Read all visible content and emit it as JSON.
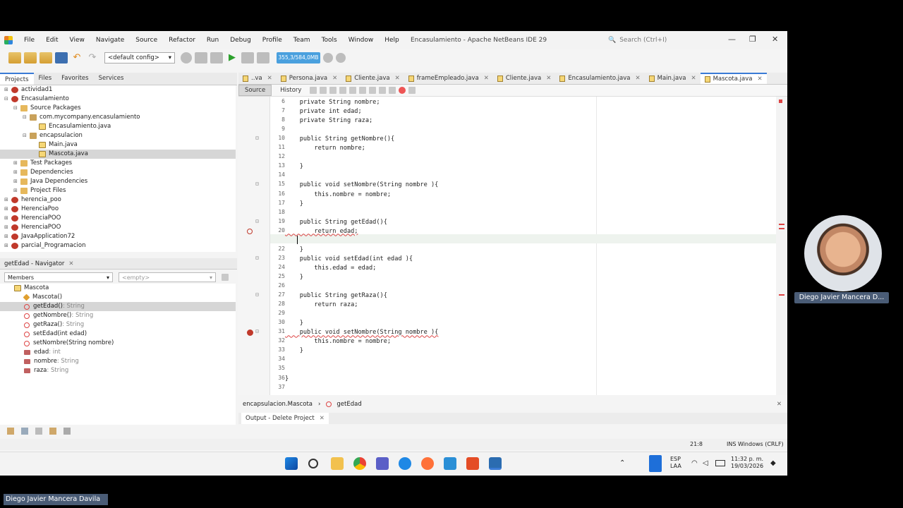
{
  "window": {
    "title": "Encasulamiento - Apache NetBeans IDE 29",
    "search_placeholder": "Search (Ctrl+I)",
    "menu": [
      "File",
      "Edit",
      "View",
      "Navigate",
      "Source",
      "Refactor",
      "Run",
      "Debug",
      "Profile",
      "Team",
      "Tools",
      "Window",
      "Help"
    ]
  },
  "toolbar": {
    "config": "<default config>",
    "memory": "355,3/584,0MB"
  },
  "left_tabs": [
    "Projects",
    "Files",
    "Favorites",
    "Services"
  ],
  "projects": [
    {
      "label": "actividad1",
      "indent": 0,
      "icon": "proj",
      "exp": "⊞"
    },
    {
      "label": "Encasulamiento",
      "indent": 0,
      "icon": "proj",
      "exp": "⊟"
    },
    {
      "label": "Source Packages",
      "indent": 1,
      "icon": "folder",
      "exp": "⊟"
    },
    {
      "label": "com.mycompany.encasulamiento",
      "indent": 2,
      "icon": "pkg",
      "exp": "⊟"
    },
    {
      "label": "Encasulamiento.java",
      "indent": 3,
      "icon": "java",
      "exp": ""
    },
    {
      "label": "encapsulacion",
      "indent": 2,
      "icon": "pkg",
      "exp": "⊟"
    },
    {
      "label": "Main.java",
      "indent": 3,
      "icon": "java",
      "exp": ""
    },
    {
      "label": "Mascota.java",
      "indent": 3,
      "icon": "java",
      "exp": "",
      "selected": true
    },
    {
      "label": "Test Packages",
      "indent": 1,
      "icon": "folder",
      "exp": "⊞"
    },
    {
      "label": "Dependencies",
      "indent": 1,
      "icon": "folder",
      "exp": "⊞"
    },
    {
      "label": "Java Dependencies",
      "indent": 1,
      "icon": "folder",
      "exp": "⊞"
    },
    {
      "label": "Project Files",
      "indent": 1,
      "icon": "folder",
      "exp": "⊞"
    },
    {
      "label": "herencia_poo",
      "indent": 0,
      "icon": "proj",
      "exp": "⊞"
    },
    {
      "label": "HerenciaPoo",
      "indent": 0,
      "icon": "proj",
      "exp": "⊞"
    },
    {
      "label": "HerenciaPOO",
      "indent": 0,
      "icon": "proj",
      "exp": "⊞"
    },
    {
      "label": "HerenciaPOO",
      "indent": 0,
      "icon": "proj",
      "exp": "⊞"
    },
    {
      "label": "JavaApplication72",
      "indent": 0,
      "icon": "proj",
      "exp": "⊞"
    },
    {
      "label": "parcial_Programacion",
      "indent": 0,
      "icon": "proj",
      "exp": "⊞"
    }
  ],
  "navigator": {
    "title": "getEdad - Navigator",
    "members_label": "Members",
    "filter_label": "<empty>",
    "root": "Mascota",
    "items": [
      {
        "name": "Mascota()",
        "type": "",
        "kind": "ctor"
      },
      {
        "name": "getEdad()",
        "type": " : String",
        "kind": "method",
        "selected": true
      },
      {
        "name": "getNombre()",
        "type": " : String",
        "kind": "method"
      },
      {
        "name": "getRaza()",
        "type": " : String",
        "kind": "method"
      },
      {
        "name": "setEdad(int edad)",
        "type": "",
        "kind": "method"
      },
      {
        "name": "setNombre(String nombre)",
        "type": "",
        "kind": "method"
      },
      {
        "name": "edad",
        "type": " : int",
        "kind": "field"
      },
      {
        "name": "nombre",
        "type": " : String",
        "kind": "field"
      },
      {
        "name": "raza",
        "type": " : String",
        "kind": "field"
      }
    ]
  },
  "editor_tabs": [
    {
      "label": "..va",
      "active": false
    },
    {
      "label": "Persona.java",
      "active": false
    },
    {
      "label": "Cliente.java",
      "active": false
    },
    {
      "label": "frameEmpleado.java",
      "active": false
    },
    {
      "label": "Cliente.java",
      "active": false
    },
    {
      "label": "Encasulamiento.java",
      "active": false
    },
    {
      "label": "Main.java",
      "active": false
    },
    {
      "label": "Mascota.java",
      "active": true
    }
  ],
  "editor_toolbar": {
    "source": "Source",
    "history": "History"
  },
  "code_lines": [
    {
      "n": "6",
      "text": "    private String nombre;"
    },
    {
      "n": "7",
      "text": "    private int edad;"
    },
    {
      "n": "8",
      "text": "    private String raza;"
    },
    {
      "n": "9",
      "text": ""
    },
    {
      "n": "10",
      "text": "    public String getNombre(){"
    },
    {
      "n": "11",
      "text": "        return nombre;"
    },
    {
      "n": "12",
      "text": ""
    },
    {
      "n": "13",
      "text": "    }"
    },
    {
      "n": "14",
      "text": ""
    },
    {
      "n": "15",
      "text": "    public void setNombre(String nombre ){"
    },
    {
      "n": "16",
      "text": "        this.nombre = nombre;"
    },
    {
      "n": "17",
      "text": "    }"
    },
    {
      "n": "18",
      "text": ""
    },
    {
      "n": "19",
      "text": "    public String getEdad(){"
    },
    {
      "n": "20",
      "text": "        return edad;"
    },
    {
      "n": "21",
      "text": ""
    },
    {
      "n": "22",
      "text": "    }"
    },
    {
      "n": "23",
      "text": "    public void setEdad(int edad ){"
    },
    {
      "n": "24",
      "text": "        this.edad = edad;"
    },
    {
      "n": "25",
      "text": "    }"
    },
    {
      "n": "26",
      "text": ""
    },
    {
      "n": "27",
      "text": "    public String getRaza(){"
    },
    {
      "n": "28",
      "text": "        return raza;"
    },
    {
      "n": "29",
      "text": ""
    },
    {
      "n": "30",
      "text": "    }"
    },
    {
      "n": "31",
      "text": "    public void setNombre(String nombre ){"
    },
    {
      "n": "32",
      "text": "        this.nombre = nombre;"
    },
    {
      "n": "33",
      "text": "    }"
    },
    {
      "n": "34",
      "text": ""
    },
    {
      "n": "35",
      "text": ""
    },
    {
      "n": "36",
      "text": "}"
    },
    {
      "n": "37",
      "text": ""
    }
  ],
  "breadcrumbs": {
    "class": "encapsulacion.Mascota",
    "method": "getEdad"
  },
  "output": {
    "tab": "Output - Delete Project"
  },
  "status": {
    "position": "21:8",
    "mode": "INS Windows (CRLF)"
  },
  "taskbar": {
    "lang": "ESP",
    "lang2": "LAA",
    "time": "11:32 p. m.",
    "date": "19/03/2026"
  },
  "webcam": {
    "name": "Diego Javier Mancera D..."
  },
  "bottom_label": "Diego Javier Mancera Davila",
  "colors": {
    "accent": "#3a7bd5",
    "memory": "#4aa0de",
    "error": "#dd4444",
    "name_tag": "#4a5c76"
  }
}
